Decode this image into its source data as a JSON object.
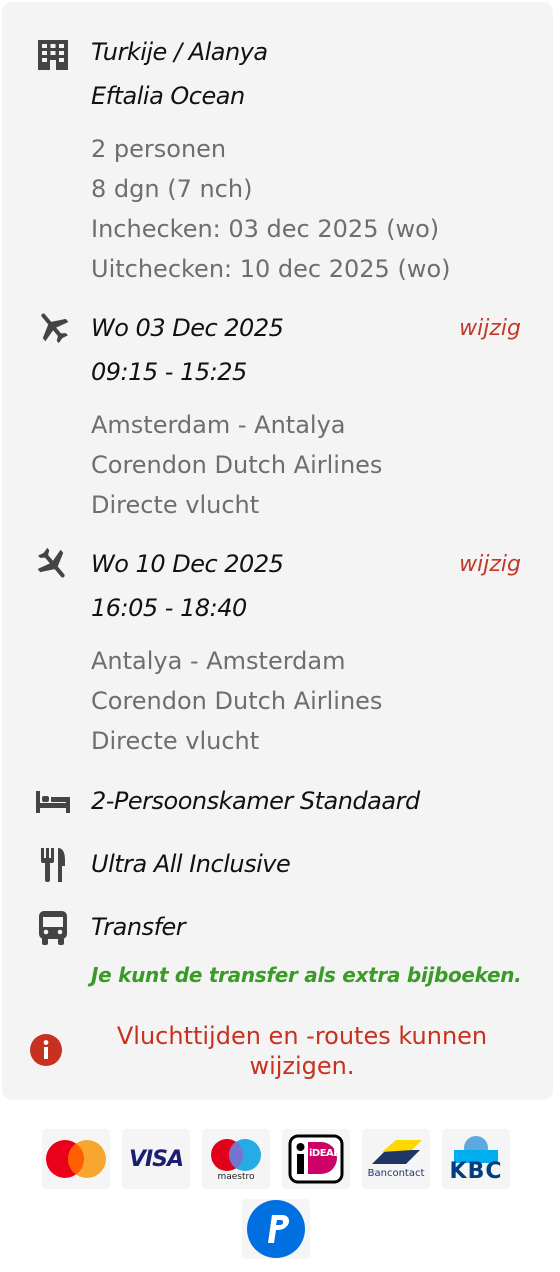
{
  "hotel": {
    "destination": "Turkije / Alanya",
    "name": "Eftalia Ocean",
    "persons": "2 personen",
    "duration": "8 dgn (7 nch)",
    "checkin": "Inchecken: 03 dec 2025 (wo)",
    "checkout": "Uitchecken: 10 dec 2025 (wo)"
  },
  "outbound": {
    "date": "Wo 03 Dec 2025",
    "time": "09:15 - 15:25",
    "change_label": "wijzig",
    "route": "Amsterdam - Antalya",
    "airline": "Corendon Dutch Airlines",
    "type": "Directe vlucht"
  },
  "return": {
    "date": "Wo 10 Dec 2025",
    "time": "16:05 - 18:40",
    "change_label": "wijzig",
    "route": "Antalya - Amsterdam",
    "airline": "Corendon Dutch Airlines",
    "type": "Directe vlucht"
  },
  "room": "2-Persoonskamer Standaard",
  "board": "Ultra All Inclusive",
  "transfer": {
    "title": "Transfer",
    "note": "Je kunt de transfer als extra bijboeken."
  },
  "notice": "Vluchttijden en -routes kunnen wijzigen.",
  "payment_logos": {
    "visa": "VISA",
    "maestro": "maestro",
    "ideal": "iDEAL",
    "bancontact": "Bancontact",
    "kbc": "KBC"
  },
  "colors": {
    "accent_red": "#c0392b",
    "green": "#3a9b27",
    "card_bg": "#f4f4f4"
  }
}
